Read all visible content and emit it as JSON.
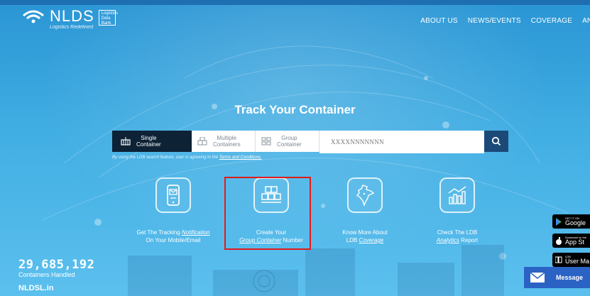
{
  "header": {
    "logo_text": "NLDS",
    "logo_tagline": "Logistics Redefined",
    "logo_box_lines": [
      "Logistics",
      "Data",
      "Bank"
    ],
    "nav": [
      "ABOUT US",
      "NEWS/EVENTS",
      "COVERAGE",
      "ANAL"
    ]
  },
  "main": {
    "title": "Track Your Container",
    "search": {
      "tabs": [
        {
          "line1": "Single",
          "line2": "Container",
          "active": true
        },
        {
          "line1": "Multiple",
          "line2": "Containers",
          "active": false
        },
        {
          "line1": "Group",
          "line2": "Container",
          "active": false
        }
      ],
      "placeholder": "XXXXNNNNNNN",
      "disclaimer_prefix": "By using the LDB search feature, user is agreeing to the ",
      "disclaimer_link": "Terms and Conditions."
    },
    "features": [
      {
        "line1_pre": "Get The Tracking ",
        "line1_link": "Notification",
        "line1_post": "",
        "line2_pre": "On Your Mobile/Email",
        "line2_link": "",
        "line2_post": ""
      },
      {
        "line1_pre": "Create Your",
        "line1_link": "",
        "line1_post": "",
        "line2_pre": "",
        "line2_link": "Group Container",
        "line2_post": " Number"
      },
      {
        "line1_pre": "Know More About",
        "line1_link": "",
        "line1_post": "",
        "line2_pre": "LDB ",
        "line2_link": "Coverage",
        "line2_post": ""
      },
      {
        "line1_pre": "Check The LDB",
        "line1_link": "",
        "line1_post": "",
        "line2_pre": "",
        "line2_link": "Analytics",
        "line2_post": " Report"
      }
    ]
  },
  "stats": {
    "count": "29,685,192",
    "label": "Containers Handled",
    "site": "NLDSL.in"
  },
  "badges": [
    {
      "small": "GET IT ON",
      "big": "Google"
    },
    {
      "small": "Download on the",
      "big": "App St"
    },
    {
      "small": "LDB",
      "big": "User Ma"
    }
  ],
  "message": {
    "label": "Message"
  },
  "colors": {
    "accent_dark": "#0e2236",
    "search_button": "#1b4a78",
    "highlight": "#e21a1a",
    "message": "#2b63c5"
  }
}
